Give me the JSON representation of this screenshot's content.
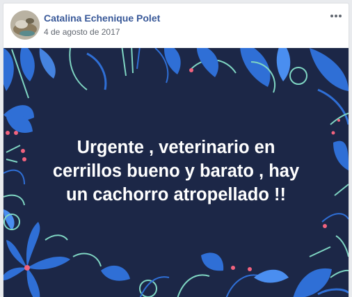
{
  "post": {
    "author_name": "Catalina Echenique Polet",
    "timestamp": "4 de agosto de 2017",
    "more_icon": "more-options-icon",
    "message": "Urgente , veterinario en\ncerrillos bueno y barato , hay\nun cachorro atropellado !!"
  },
  "colors": {
    "background": "#1c2747",
    "leaf_blue": "#2f6fd6",
    "leaf_light": "#4a8ef0",
    "line_teal": "#7fd6c3",
    "dot_pink": "#f2637e",
    "author_link": "#385898"
  }
}
